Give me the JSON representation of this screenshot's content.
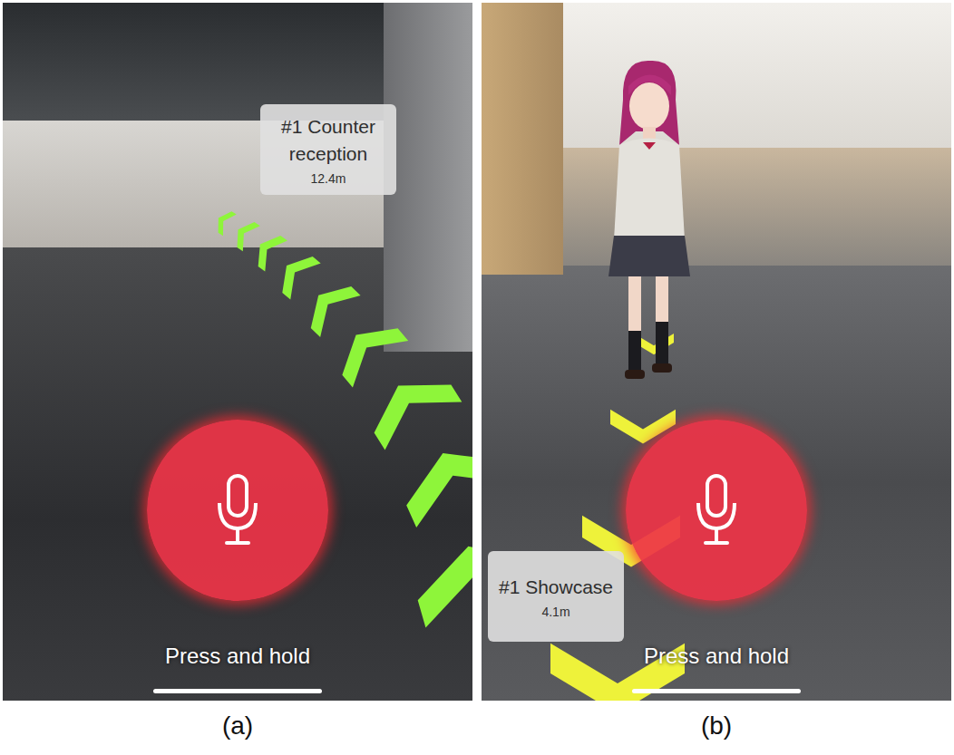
{
  "panels": [
    {
      "caption": "(a)",
      "kind": "route",
      "destination": {
        "name": "#1 Counter reception",
        "distance": "12.4m"
      },
      "color": "#8ef53a",
      "avatar": false,
      "mic_label": "Press and hold"
    },
    {
      "caption": "(b)",
      "kind": "avatar",
      "destination": {
        "name": "#1 Showcase",
        "distance": "4.1m"
      },
      "color": "#eef23a",
      "avatar": true,
      "mic_label": "Press and hold"
    }
  ]
}
